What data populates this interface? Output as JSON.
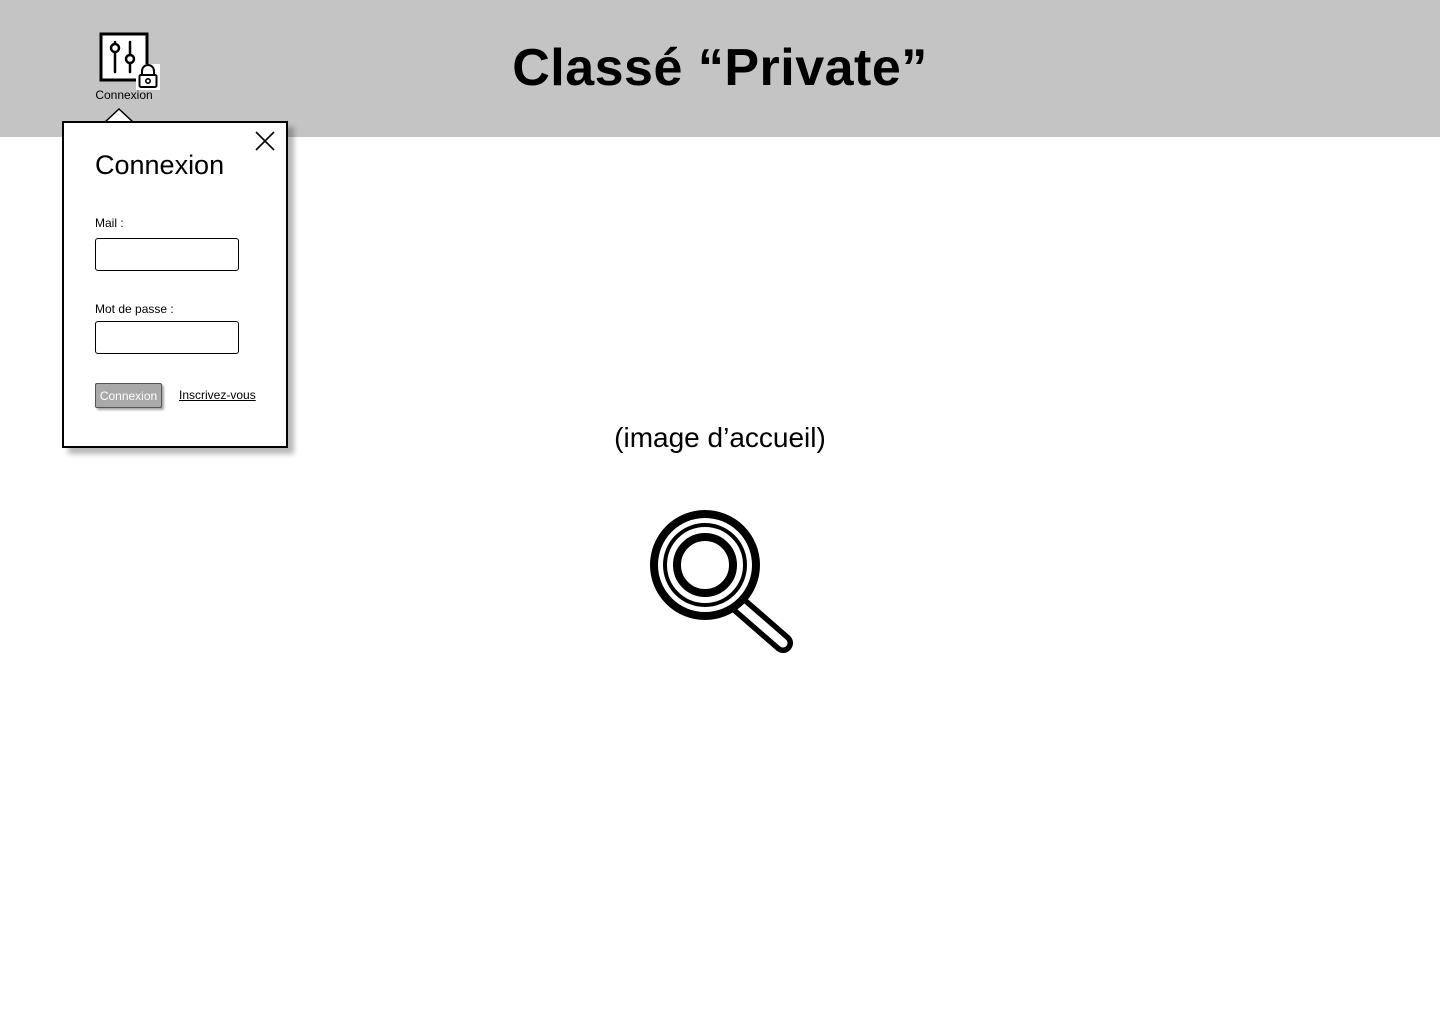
{
  "header": {
    "title": "Classé “Private”",
    "background": "#c4c4c4"
  },
  "login_trigger": {
    "label": "Connexion",
    "icon": "settings-sliders-icon",
    "badge_icon": "lock-icon"
  },
  "login_popover": {
    "title": "Connexion",
    "mail_label": "Mail :",
    "mail_value": "",
    "password_label": "Mot de passe :",
    "password_value": "",
    "submit_label": "Connexion",
    "signup_label": "Inscrivez-vous",
    "close_icon": "close-icon"
  },
  "main": {
    "welcome_caption": "(image d’accueil)",
    "search_icon": "search-icon"
  }
}
